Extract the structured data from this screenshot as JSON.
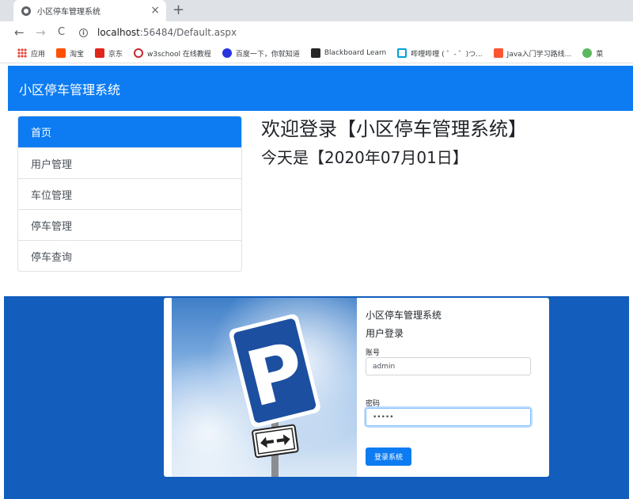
{
  "browser": {
    "tab_title": "小区停车管理系统",
    "tab_close": "×",
    "new_tab": "+",
    "back": "←",
    "forward": "→",
    "reload": "C",
    "url_host": "localhost",
    "url_path": ":56484/Default.aspx",
    "bookmarks": [
      {
        "label": "应用",
        "icon": "apps-grid-icon",
        "color": "#4285f4"
      },
      {
        "label": "淘宝",
        "icon": "taobao-icon",
        "color": "#ff5000"
      },
      {
        "label": "京东",
        "icon": "jd-icon",
        "color": "#e1251b"
      },
      {
        "label": "w3school 在线教程",
        "icon": "w3school-icon",
        "color": "#c7282f"
      },
      {
        "label": "百度一下，你就知道",
        "icon": "baidu-paw-icon",
        "color": "#2932e1"
      },
      {
        "label": "Blackboard Learn",
        "icon": "blackboard-icon",
        "color": "#262626"
      },
      {
        "label": "哔哩哔哩 ( ゜- ゜)つ...",
        "icon": "bilibili-icon",
        "color": "#00a1d6"
      },
      {
        "label": "Java入门学习路线...",
        "icon": "csdn-icon",
        "color": "#fc5531"
      },
      {
        "label": "菜",
        "icon": "runoob-icon",
        "color": "#5cb85c"
      }
    ]
  },
  "app": {
    "brand": "小区停车管理系统",
    "nav": [
      "首页",
      "用户管理",
      "车位管理",
      "停车管理",
      "停车查询"
    ],
    "welcome_title": "欢迎登录【小区停车管理系统】",
    "welcome_date": "今天是【2020年07月01日】",
    "accent": "#0d7cf2"
  },
  "login": {
    "title": "小区停车管理系统",
    "subtitle": "用户登录",
    "account_label": "账号",
    "account_value": "admin",
    "password_label": "密码",
    "password_value": "•••••",
    "submit": "登录系统",
    "photo_icon": "parking-sign-photo",
    "background": "#135dbd"
  }
}
